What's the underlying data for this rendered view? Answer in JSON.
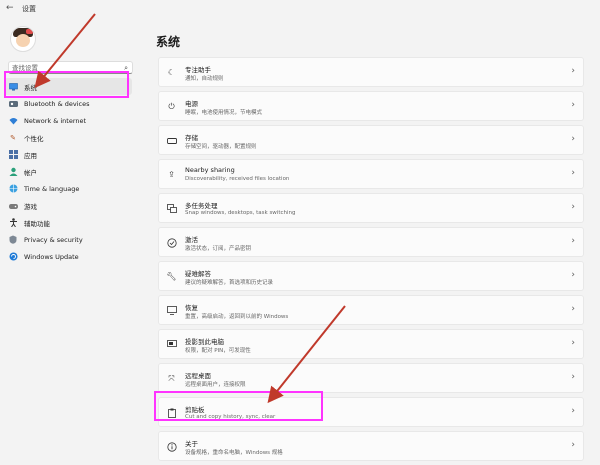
{
  "window": {
    "title": "设置"
  },
  "sidebar": {
    "search_placeholder": "查找设置",
    "items": [
      {
        "label": "系统",
        "icon": "monitor-icon"
      },
      {
        "label": "Bluetooth & devices",
        "icon": "bluetooth-icon"
      },
      {
        "label": "Network & internet",
        "icon": "wifi-icon"
      },
      {
        "label": "个性化",
        "icon": "brush-icon"
      },
      {
        "label": "应用",
        "icon": "apps-icon"
      },
      {
        "label": "帐户",
        "icon": "person-icon"
      },
      {
        "label": "Time & language",
        "icon": "globe-icon"
      },
      {
        "label": "游戏",
        "icon": "gamepad-icon"
      },
      {
        "label": "辅助功能",
        "icon": "accessibility-icon"
      },
      {
        "label": "Privacy & security",
        "icon": "shield-icon"
      },
      {
        "label": "Windows Update",
        "icon": "update-icon"
      }
    ]
  },
  "main": {
    "title": "系统",
    "cards": [
      {
        "title": "专注助手",
        "sub": "通知，自动规则",
        "icon": "moon-icon"
      },
      {
        "title": "电源",
        "sub": "睡眠，电池使用情况，节电模式",
        "icon": "power-icon"
      },
      {
        "title": "存储",
        "sub": "存储空间，驱动器，配置规则",
        "icon": "storage-icon"
      },
      {
        "title": "Nearby sharing",
        "sub": "Discoverability, received files location",
        "icon": "share-icon"
      },
      {
        "title": "多任务处理",
        "sub": "Snap windows, desktops, task switching",
        "icon": "multitask-icon"
      },
      {
        "title": "激活",
        "sub": "激活状态，订阅，产品密钥",
        "icon": "check-circle-icon"
      },
      {
        "title": "疑难解答",
        "sub": "建议的疑难解答，首选项和历史记录",
        "icon": "wrench-icon"
      },
      {
        "title": "恢复",
        "sub": "重置，高级启动，返回到以前的 Windows",
        "icon": "recovery-icon"
      },
      {
        "title": "投影到此电脑",
        "sub": "权限，配对 PIN，可发现性",
        "icon": "projector-icon"
      },
      {
        "title": "远程桌面",
        "sub": "远程桌面用户，连接权限",
        "icon": "remote-desktop-icon"
      },
      {
        "title": "剪贴板",
        "sub": "Cut and copy history, sync, clear",
        "icon": "clipboard-icon"
      },
      {
        "title": "关于",
        "sub": "设备规格，重命名电脑，Windows 规格",
        "icon": "info-icon"
      }
    ]
  },
  "colors": {
    "highlight": "#ff33ff",
    "arrow": "#c0392b",
    "accent": "#0067c0"
  }
}
